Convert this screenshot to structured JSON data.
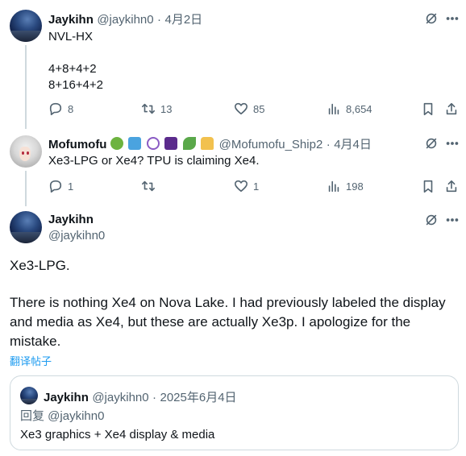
{
  "tweet1": {
    "display_name": "Jaykihn",
    "handle": "@jaykihn0",
    "separator": "·",
    "date": "4月2日",
    "lines": [
      "NVL-HX",
      "",
      "4+8+4+2",
      "8+16+4+2"
    ],
    "replies": "8",
    "retweets": "13",
    "likes": "85",
    "views": "8,654"
  },
  "tweet2": {
    "display_name": "Mofumofu",
    "handle": "@Mofumofu_Ship2",
    "separator": "·",
    "date": "4月4日",
    "text": "Xe3-LPG or Xe4? TPU is claiming Xe4.",
    "replies": "1",
    "retweets": "",
    "likes": "1",
    "views": "198"
  },
  "main_tweet": {
    "display_name": "Jaykihn",
    "handle": "@jaykihn0",
    "paragraph1": "Xe3-LPG.",
    "paragraph2_line1": "There is nothing Xe4 on Nova Lake. I had previously labeled the display",
    "paragraph2_line2": "and media as Xe4, but these are actually Xe3p. I apologize for the",
    "paragraph2_line3": "mistake.",
    "translate_label": "翻译帖子"
  },
  "quote": {
    "display_name": "Jaykihn",
    "handle": "@jaykihn0",
    "separator": "·",
    "date": "2025年6月4日",
    "reply_to": "回复 @jaykihn0",
    "text": "Xe3 graphics + Xe4 display & media"
  },
  "icons": {
    "reply": "reply-icon",
    "retweet": "retweet-icon",
    "like": "heart-icon",
    "views": "views-icon",
    "bookmark": "bookmark-icon",
    "share": "share-icon",
    "grok": "grok-icon",
    "more": "more-icon"
  },
  "colors": {
    "link": "#1d9bf0",
    "muted": "#536471",
    "divider": "#cfd9de"
  }
}
